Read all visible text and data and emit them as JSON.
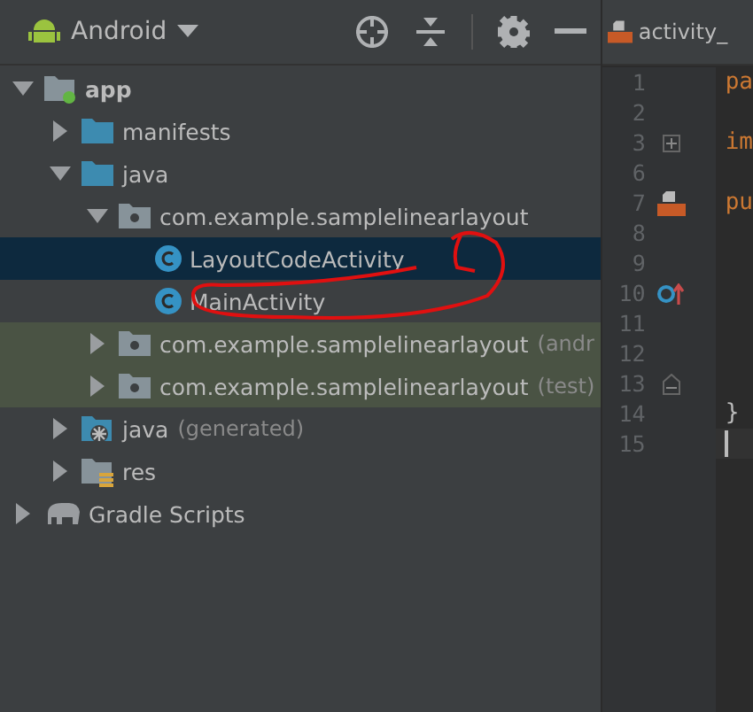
{
  "project_panel": {
    "view": "Android",
    "tree": [
      {
        "label": "app",
        "kind": "module",
        "expanded": true,
        "selected": false,
        "tinted": false,
        "children": [
          {
            "label": "manifests",
            "kind": "folder",
            "expanded": false,
            "selected": false,
            "tinted": false
          },
          {
            "label": "java",
            "kind": "folder",
            "expanded": true,
            "selected": false,
            "tinted": false,
            "children": [
              {
                "label": "com.example.samplelinearlayout",
                "kind": "package",
                "expanded": true,
                "selected": false,
                "tinted": false,
                "children": [
                  {
                    "label": "LayoutCodeActivity",
                    "kind": "class",
                    "selected": true,
                    "tinted": false
                  },
                  {
                    "label": "MainActivity",
                    "kind": "class",
                    "selected": false,
                    "tinted": false
                  }
                ]
              },
              {
                "label": "com.example.samplelinearlayout",
                "note": "(andr",
                "kind": "package",
                "expanded": false,
                "selected": false,
                "tinted": true
              },
              {
                "label": "com.example.samplelinearlayout",
                "note": "(test)",
                "kind": "package",
                "expanded": false,
                "selected": false,
                "tinted": true
              }
            ]
          },
          {
            "label": "java",
            "note": "(generated)",
            "kind": "generated",
            "expanded": false,
            "selected": false,
            "tinted": false
          },
          {
            "label": "res",
            "kind": "res",
            "expanded": false,
            "selected": false,
            "tinted": false
          }
        ]
      },
      {
        "label": "Gradle Scripts",
        "kind": "gradle",
        "expanded": false,
        "selected": false,
        "tinted": false
      }
    ]
  },
  "editor": {
    "tab": "activity_",
    "lines": [
      {
        "number": "1",
        "code": "pa",
        "kind": "keyword",
        "current": false
      },
      {
        "number": "2",
        "kind": "blank",
        "current": false
      },
      {
        "number": "3",
        "code": "im",
        "kind": "keyword",
        "gutter": {
          "kind": "fold-closed"
        },
        "current": false
      },
      {
        "number": "6",
        "kind": "blank",
        "current": false
      },
      {
        "number": "7",
        "code": "pu",
        "kind": "keyword",
        "gutter": {
          "kind": "layout"
        },
        "current": false
      },
      {
        "number": "8",
        "kind": "blank",
        "current": false
      },
      {
        "number": "9",
        "kind": "blank",
        "current": false
      },
      {
        "number": "10",
        "kind": "blank",
        "gutter": {
          "kind": "override"
        },
        "current": false
      },
      {
        "number": "11",
        "kind": "blank",
        "current": false
      },
      {
        "number": "12",
        "kind": "blank",
        "current": false
      },
      {
        "number": "13",
        "kind": "blank",
        "gutter": {
          "kind": "fold-end"
        },
        "current": false
      },
      {
        "number": "14",
        "code": "}",
        "kind": "plain",
        "current": false
      },
      {
        "number": "15",
        "kind": "blank",
        "current": true
      }
    ]
  }
}
